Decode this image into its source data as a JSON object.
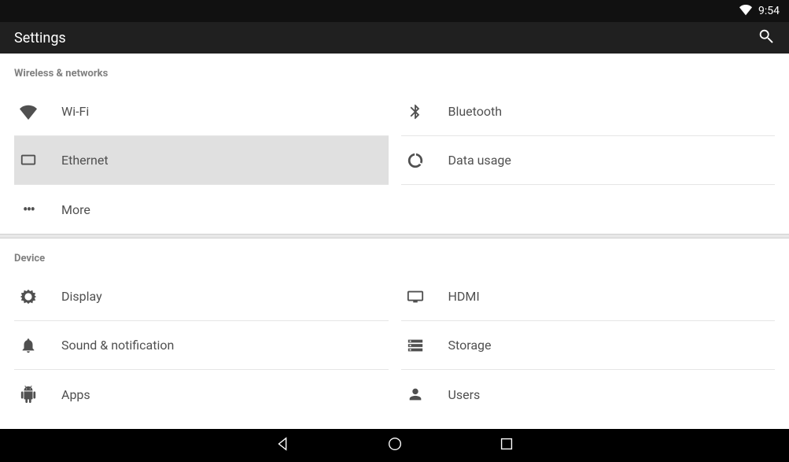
{
  "status": {
    "time": "9:54"
  },
  "header": {
    "title": "Settings"
  },
  "sections": {
    "wireless": {
      "title": "Wireless & networks",
      "wifi": "Wi-Fi",
      "bluetooth": "Bluetooth",
      "ethernet": "Ethernet",
      "data_usage": "Data usage",
      "more": "More"
    },
    "device": {
      "title": "Device",
      "display": "Display",
      "hdmi": "HDMI",
      "sound": "Sound & notification",
      "storage": "Storage",
      "apps": "Apps",
      "users": "Users"
    }
  }
}
